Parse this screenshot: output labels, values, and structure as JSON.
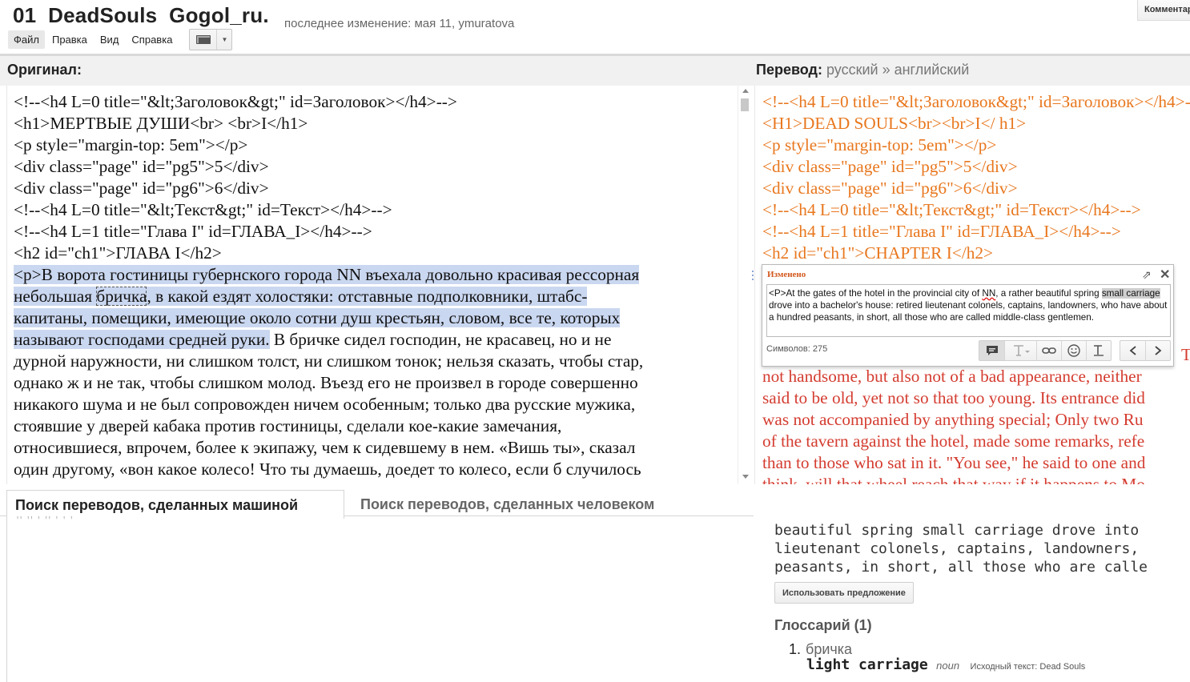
{
  "header": {
    "title": "01  DeadSouls  Gogol_ru.",
    "last_edit": "последнее изменение: мая 11, ymuratova",
    "comment_button": "Комментар"
  },
  "menu": {
    "items": [
      {
        "label": "Файл",
        "active": true
      },
      {
        "label": "Правка",
        "active": false
      },
      {
        "label": "Вид",
        "active": false
      },
      {
        "label": "Справка",
        "active": false
      }
    ]
  },
  "panels": {
    "original_label": "Оригинал:",
    "translation_label": "Перевод:",
    "translation_langs": "русский  »  английский"
  },
  "source": {
    "lines_before": [
      "<!--<h4 L=0 title=\"&lt;Заголовок&gt;\" id=Заголовок></h4>-->",
      "<h1>МЕРТВЫЕ ДУШИ<br> <br>I</h1>",
      "<p style=\"margin-top: 5em\"></p>",
      "<div class=\"page\" id=\"pg5\">5</div>",
      "<div class=\"page\" id=\"pg6\">6</div>",
      "<!--<h4 L=0 title=\"&lt;Текст&gt;\" id=Текст></h4>-->",
      "<!--<h4 L=1 title=\"Глава I\" id=ГЛАВА_I></h4>-->",
      "<h2 id=\"ch1\">ГЛАВА I</h2>"
    ],
    "hl_line1": "<p>В ворота гостиницы губернского города NN въехала довольно красивая рессорная",
    "hl_line2_pre": "небольшая ",
    "hl_word": "бричка",
    "hl_line2_post": ", в какой ездят холостяки: отставные подполковники, штабс-",
    "hl_line3": "капитаны, помещики, имеющие около сотни душ крестьян, словом, все те, которых",
    "hl_line4": "называют господами средней руки.",
    "line4_rest": " В бричке сидел господин, не красавец, но и не",
    "lines_after": [
      "дурной наружности, ни слишком толст, ни слишком тонок; нельзя сказать, чтобы стар,",
      "однако ж и не так, чтобы слишком молод. Въезд его не произвел в городе совершенно",
      "никакого шума и не был сопровожден ничем особенным; только два русские мужика,",
      "стоявшие у дверей кабака против гостиницы, сделали кое-какие замечания,",
      "относившиеся, впрочем, более к экипажу, чем к сидевшему в нем. «Вишь ты», сказал",
      "один другому, «вон какое колесо! Что ты думаешь, доедет то колесо, если б случилось"
    ]
  },
  "translation": {
    "orange_lines": [
      "<!--<h4 L=0 title=\"&lt;Заголовок&gt;\" id=Заголовок></h4>-->",
      "<H1>DEAD SOULS<br><br>I</ h1>",
      "<p style=\"margin-top: 5em\"></p>",
      "<div class=\"page\" id=\"pg5\">5</div>",
      "<div class=\"page\" id=\"pg6\">6</div>",
      "<!--<h4 L=0 title=\"&lt;Текст&gt;\" id=Текст></h4>-->",
      "<!--<h4 L=1 title=\"Глава I\" id=ГЛАВА_I></h4>-->",
      "<h2 id=\"ch1\">CHAPTER I</h2>"
    ],
    "red_partial": "T",
    "red_lines": [
      "not handsome, but also not of a bad appearance, neither",
      "said to be old, yet not so that too young. Its entrance did",
      "was not accompanied by anything special; Only two Ru",
      "of the tavern against the hotel, made some remarks, refe",
      "than to those who sat in it. \"You see,\" he said to one and",
      "think, will that wheel reach that way if it happens to Mo"
    ]
  },
  "edit_popup": {
    "label": "Изменено",
    "text_pre": "<P>At the gates of the hotel in the provincial city of ",
    "text_nn": "NN",
    "text_mid": ", a rather beautiful spring ",
    "text_selected": "small carriage",
    "text_post": " drove into a bachelor's house: retired lieutenant colonels, captains, landowners, who have about a hundred peasants, in short, all those who are called middle-class gentlemen.",
    "char_count": "Символов: 275",
    "icons": [
      "comment-icon",
      "text-style-icon",
      "link-icon",
      "smiley-icon",
      "clear-format-icon",
      "prev-icon",
      "next-icon"
    ]
  },
  "tabs": {
    "machine": "Поиск переводов, сделанных машиной",
    "human": "Поиск переводов, сделанных человеком",
    "residue": "ꞌꞌ  ꞌꞌ    ꞌ  ꞌꞌ   ꞌ  ꞌ  ꞌ"
  },
  "suggestion": {
    "lines": [
      "beautiful spring small carriage drove into",
      "lieutenant colonels, captains, landowners,",
      "peasants, in short, all those who are calle"
    ],
    "use_button": "Использовать предложение"
  },
  "glossary": {
    "title": "Глоссарий (1)",
    "items": [
      {
        "num": "1.",
        "source": "бричка",
        "target": "light carriage",
        "pos": "noun",
        "src_text": "Исходный текст: Dead Souls"
      }
    ]
  },
  "colors": {
    "highlight": "#cad7f0",
    "orange": "#e8771e",
    "red": "#d43c30",
    "edit_label": "#d35a20"
  }
}
